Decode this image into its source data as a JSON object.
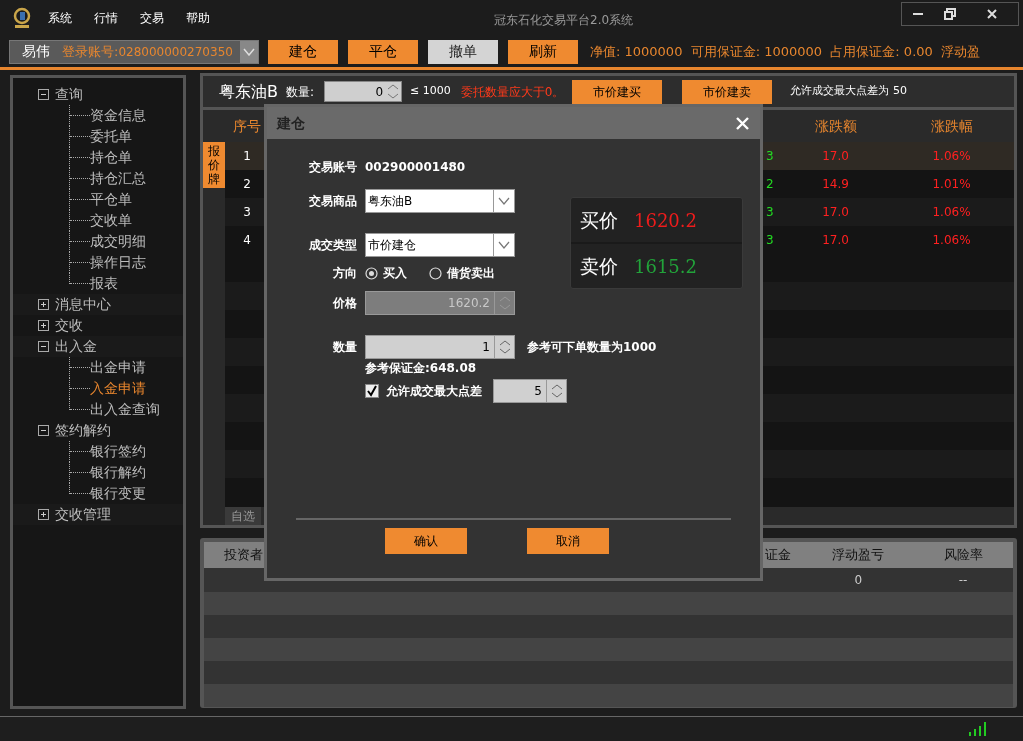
{
  "window": {
    "title": "冠东石化交易平台2.0系统"
  },
  "menu": [
    "系统",
    "行情",
    "交易",
    "帮助"
  ],
  "toolbar": {
    "user": "易伟",
    "account_label": "登录账号:",
    "account": "028000000270350",
    "buttons": [
      {
        "label": "建仓",
        "disabled": false
      },
      {
        "label": "平仓",
        "disabled": false
      },
      {
        "label": "撤单",
        "disabled": true
      },
      {
        "label": "刷新",
        "disabled": false
      }
    ],
    "summary": "净值: 1000000  可用保证金: 1000000  占用保证金: 0.00  浮动盈"
  },
  "sidebar": {
    "items": [
      {
        "label": "查询",
        "expanded": true,
        "selected": false,
        "children": [
          {
            "label": "资金信息",
            "selected": false
          },
          {
            "label": "委托单",
            "selected": false
          },
          {
            "label": "持仓单",
            "selected": false
          },
          {
            "label": "持仓汇总",
            "selected": false
          },
          {
            "label": "平仓单",
            "selected": false
          },
          {
            "label": "交收单",
            "selected": false
          },
          {
            "label": "成交明细",
            "selected": false
          },
          {
            "label": "操作日志",
            "selected": false
          },
          {
            "label": "报表",
            "selected": false
          }
        ]
      },
      {
        "label": "消息中心",
        "expanded": false,
        "selected": false
      },
      {
        "label": "交收",
        "expanded": false,
        "selected": false
      },
      {
        "label": "出入金",
        "expanded": true,
        "selected": false,
        "children": [
          {
            "label": "出金申请",
            "selected": false
          },
          {
            "label": "入金申请",
            "selected": true
          },
          {
            "label": "出入金查询",
            "selected": false
          }
        ]
      },
      {
        "label": "签约解约",
        "expanded": true,
        "selected": false,
        "children": [
          {
            "label": "银行签约",
            "selected": false
          },
          {
            "label": "银行解约",
            "selected": false
          },
          {
            "label": "银行变更",
            "selected": false
          }
        ]
      },
      {
        "label": "交收管理",
        "expanded": false,
        "selected": false
      }
    ]
  },
  "quote_panel": {
    "product": "粤东油B",
    "quantity_label": "数量:",
    "quantity": "0",
    "limit": "≤ 1000",
    "warning": "委托数量应大于0。",
    "buttons": [
      "市价建买",
      "市价建卖"
    ],
    "note": "允许成交最大点差为 50",
    "side_tab": "报价牌",
    "bottom_tab": "自选",
    "table": {
      "columns": [
        "序号",
        "涨跌额",
        "涨跌幅"
      ],
      "rows": [
        {
          "index": "1",
          "column_2": "3",
          "change": "17.0",
          "change_pct": "1.06%",
          "selected": true
        },
        {
          "index": "2",
          "column_2": "2",
          "change": "14.9",
          "change_pct": "1.01%",
          "selected": false
        },
        {
          "index": "3",
          "column_2": "3",
          "change": "17.0",
          "change_pct": "1.06%",
          "selected": false
        },
        {
          "index": "4",
          "column_2": "3",
          "change": "17.0",
          "change_pct": "1.06%",
          "selected": false
        }
      ]
    }
  },
  "account_table": {
    "columns": [
      "投资者",
      "证金",
      "浮动盈亏",
      "风险率"
    ],
    "rows": [
      {
        "floating_pl": "0",
        "risk_rate": "--"
      }
    ]
  },
  "dialog": {
    "title": "建仓",
    "account_label": "交易账号",
    "account": "002900001480",
    "product_label": "交易商品",
    "product": "粤东油B",
    "type_label": "成交类型",
    "type": "市价建仓",
    "direction_label": "方向",
    "directions": [
      {
        "label": "买入",
        "selected": true
      },
      {
        "label": "借货卖出",
        "selected": false
      }
    ],
    "price_label": "价格",
    "price": "1620.2",
    "price_disabled": true,
    "quantity_label": "数量",
    "quantity": "1",
    "quantity_hint": "参考可下单数量为1000",
    "margin": "参考保证金:648.08",
    "spread": {
      "label": "允许成交最大点差",
      "checked": true,
      "value": "5"
    },
    "quotes": [
      {
        "label": "买价",
        "value": "1620.2",
        "kind": "buy"
      },
      {
        "label": "卖价",
        "value": "1615.2",
        "kind": "sell"
      }
    ],
    "buttons": [
      "确认",
      "取消"
    ]
  }
}
